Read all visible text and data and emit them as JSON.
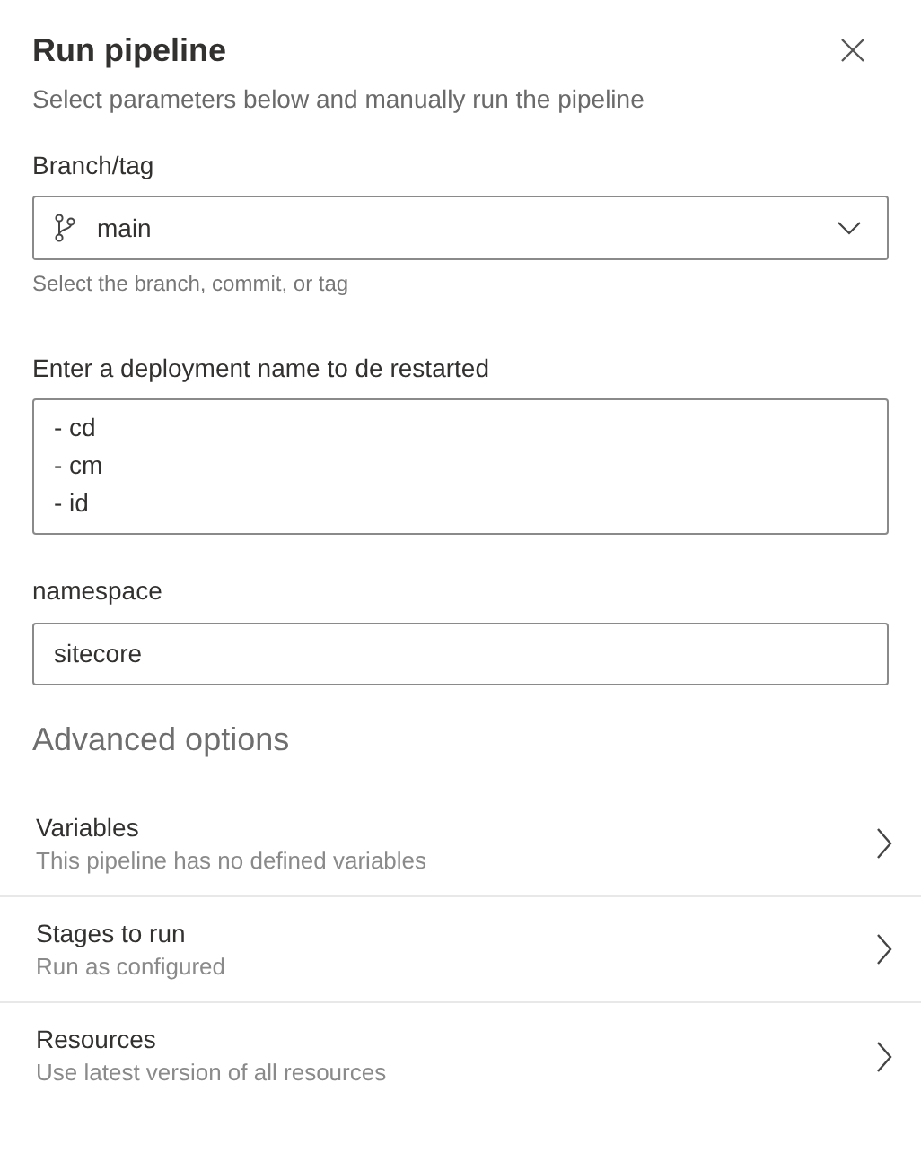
{
  "panel": {
    "title": "Run pipeline",
    "subtitle": "Select parameters below and manually run the pipeline"
  },
  "branch": {
    "label": "Branch/tag",
    "value": "main",
    "hint": "Select the branch, commit, or tag"
  },
  "deployment": {
    "label": "Enter a deployment name to de restarted",
    "value": "- cd\n- cm\n- id"
  },
  "namespace": {
    "label": "namespace",
    "value": "sitecore"
  },
  "advanced": {
    "heading": "Advanced options",
    "items": [
      {
        "title": "Variables",
        "description": "This pipeline has no defined variables"
      },
      {
        "title": "Stages to run",
        "description": "Run as configured"
      },
      {
        "title": "Resources",
        "description": "Use latest version of all resources"
      }
    ]
  }
}
